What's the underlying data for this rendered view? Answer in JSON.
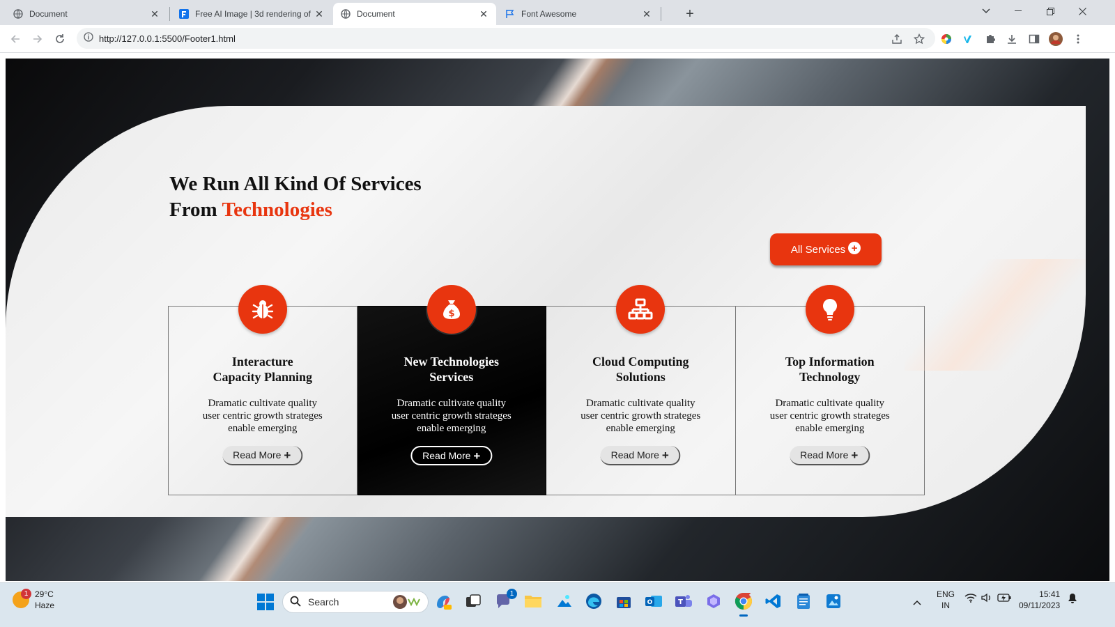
{
  "browser": {
    "tabs": [
      {
        "title": "Document",
        "icon": "globe-icon",
        "active": false
      },
      {
        "title": "Free AI Image | 3d rendering of",
        "icon": "freepik-icon",
        "active": false
      },
      {
        "title": "Document",
        "icon": "globe-icon",
        "active": true
      },
      {
        "title": "Font Awesome",
        "icon": "flag-icon",
        "active": false
      }
    ],
    "url": "http://127.0.0.1:5500/Footer1.html"
  },
  "page": {
    "heading_line1": "We Run All Kind Of Services",
    "heading_from": "From ",
    "heading_accent": "Technologies",
    "all_services_label": "All Services",
    "accent_color": "#e8350f",
    "cards": [
      {
        "icon": "bug-icon",
        "title_line1": "Interacture",
        "title_line2": "Capacity Planning",
        "desc_line1": "Dramatic cultivate quality",
        "desc_line2": "user centric growth strateges",
        "desc_line3": "enable emerging",
        "button": "Read More",
        "dark": false
      },
      {
        "icon": "money-bag-icon",
        "title_line1": "New Technologies",
        "title_line2": "Services",
        "desc_line1": "Dramatic cultivate quality",
        "desc_line2": "user centric growth strateges",
        "desc_line3": "enable emerging",
        "button": "Read More",
        "dark": true
      },
      {
        "icon": "network-icon",
        "title_line1": "Cloud Computing",
        "title_line2": "Solutions",
        "desc_line1": "Dramatic cultivate quality",
        "desc_line2": "user centric growth strateges",
        "desc_line3": "enable emerging",
        "button": "Read More",
        "dark": false
      },
      {
        "icon": "lightbulb-icon",
        "title_line1": "Top Information",
        "title_line2": "Technology",
        "desc_line1": "Dramatic cultivate quality",
        "desc_line2": "user centric growth strateges",
        "desc_line3": "enable emerging",
        "button": "Read More",
        "dark": false
      }
    ]
  },
  "taskbar": {
    "weather_temp": "29°C",
    "weather_desc": "Haze",
    "weather_badge": "1",
    "search_label": "Search",
    "chat_badge": "1",
    "lang_line1": "ENG",
    "lang_line2": "IN",
    "time": "15:41",
    "date": "09/11/2023"
  }
}
